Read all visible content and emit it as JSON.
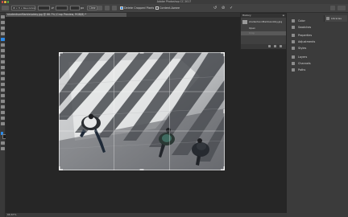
{
  "window": {
    "title": "Adobe Photoshop CC 2017"
  },
  "options_bar": {
    "preset_value": "W x H x Resolution",
    "width_unit": "px",
    "clear_label": "Clear",
    "straighten_label": "Straighten",
    "delete_cropped_label": "Delete Cropped Pixels",
    "content_aware_label": "Content-Aware"
  },
  "document": {
    "tab_title": "studentsonMarbleLobby.jpg @ 66.7% (Crop Preview, RGB/8) *",
    "zoom": "66.67%"
  },
  "history_panel": {
    "title": "History",
    "snapshot": "studentsonMarbleLobby.jpg",
    "states": [
      "Open",
      "Crop"
    ]
  },
  "panels": {
    "items": [
      "Color",
      "Swatches",
      "Properties",
      "Adjustments",
      "Styles",
      "Layers",
      "Channels",
      "Paths"
    ],
    "learn_label": "Libraries"
  },
  "colors": {
    "accent": "#2d8ceb",
    "canvas": "#262626",
    "panel": "#3b3b3b"
  }
}
